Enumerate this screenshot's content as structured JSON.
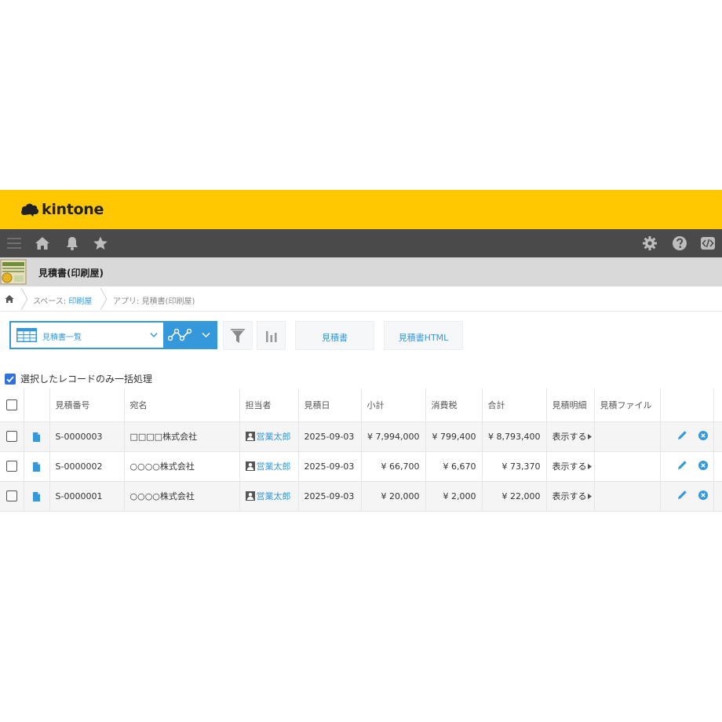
{
  "brand": {
    "name": "kintone",
    "color": "#ffc800"
  },
  "global_nav": {
    "icons": [
      "menu-icon",
      "home-icon",
      "bell-icon",
      "star-icon",
      "gear-icon",
      "help-icon",
      "code-icon"
    ]
  },
  "app": {
    "title": "見積書(印刷屋)"
  },
  "breadcrumb": {
    "space_prefix": "スペース: ",
    "space_name": "印刷屋",
    "app_prefix": "アプリ: ",
    "app_name": "見積書(印刷屋)"
  },
  "toolbar": {
    "view_name": "見積書一覧",
    "btn_quote": "見積書",
    "btn_quote_html": "見積書HTML"
  },
  "bulk": {
    "label": "選択したレコードのみ一括処理",
    "checked": true
  },
  "table": {
    "headers": [
      "見積番号",
      "宛名",
      "担当者",
      "見積日",
      "小計",
      "消費税",
      "合計",
      "見積明細",
      "見積ファイル"
    ],
    "rows": [
      {
        "number": "S-0000003",
        "addressee": "□□□□株式会社",
        "owner": "営業太郎",
        "date": "2025-09-03",
        "subtotal": "¥ 7,994,000",
        "tax": "¥ 799,400",
        "total": "¥ 8,793,400",
        "detail": "表示する",
        "file": ""
      },
      {
        "number": "S-0000002",
        "addressee": "○○○○株式会社",
        "owner": "営業太郎",
        "date": "2025-09-03",
        "subtotal": "¥ 66,700",
        "tax": "¥ 6,670",
        "total": "¥ 73,370",
        "detail": "表示する",
        "file": ""
      },
      {
        "number": "S-0000001",
        "addressee": "○○○○株式会社",
        "owner": "営業太郎",
        "date": "2025-09-03",
        "subtotal": "¥ 20,000",
        "tax": "¥ 2,000",
        "total": "¥ 22,000",
        "detail": "表示する",
        "file": ""
      }
    ]
  },
  "colors": {
    "accent": "#3498db",
    "nav_bg": "#4a4a4a",
    "app_header_bg": "#d9d9d9",
    "checkbox": "#2f73da"
  }
}
